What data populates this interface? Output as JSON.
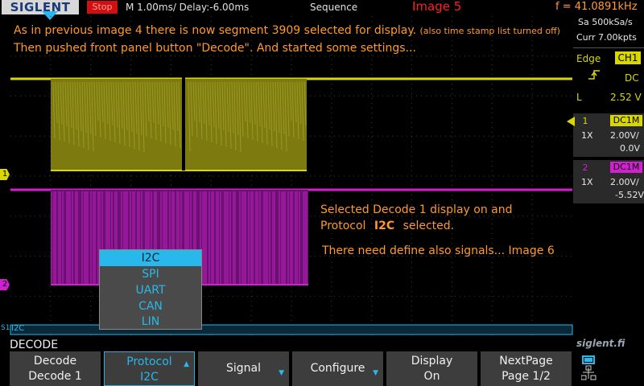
{
  "topbar": {
    "logo": "SIGLENT",
    "run_state": "Stop",
    "timebase": "M 1.00ms/ Delay:-6.00ms",
    "mode": "Sequence",
    "image_tag": "Image 5",
    "frequency": "f = 41.0891kHz"
  },
  "annotations": {
    "line1_main": "As in previous image 4 there is now segment 3909 selected for display.",
    "line1_small": "(also time stamp list turned off)",
    "line2": "Then pushed front panel button \"Decode\".  And started some settings...",
    "selected_decode": "Selected Decode 1 display on and",
    "protocol_prefix": "Protocol",
    "protocol_value": "I2C",
    "protocol_suffix": "selected.",
    "need_define": "There need define also signals... Image 6"
  },
  "right_panel": {
    "sample_rate": "Sa 500kSa/s",
    "memory": "Curr 7.00kpts",
    "trigger_type": "Edge",
    "trigger_source": "CH1",
    "coupling": "DC",
    "level_label": "L",
    "level_value": "2.52 V",
    "ch1": {
      "num": "1",
      "coupling": "DC1M",
      "probe": "1X",
      "scale": "2.00V/",
      "offset": "0.0V"
    },
    "ch2": {
      "num": "2",
      "coupling": "DC1M",
      "probe": "1X",
      "scale": "2.00V/",
      "offset": "-5.52V"
    },
    "watermark": "siglent.fi"
  },
  "markers": {
    "ch1": "1",
    "ch2": "2",
    "bus": "S1",
    "bus_label": "I2C"
  },
  "menu_title": "DECODE",
  "protocol_menu": {
    "options": [
      "I2C",
      "SPI",
      "UART",
      "CAN",
      "LIN"
    ],
    "selected_index": 0
  },
  "softkeys": [
    {
      "top": "Decode",
      "bottom": "Decode 1"
    },
    {
      "top": "Protocol",
      "bottom": "I2C"
    },
    {
      "top": "Signal",
      "bottom": ""
    },
    {
      "top": "Configure",
      "bottom": ""
    },
    {
      "top": "Display",
      "bottom": "On"
    },
    {
      "top": "NextPage",
      "bottom": "Page 1/2"
    }
  ],
  "colors": {
    "ch1": "#d8d800",
    "ch1_fill": "#7d7a10",
    "ch2": "#d020d0",
    "ch2_fill": "#6a1070",
    "accent": "#29b8ec",
    "annotation": "#ff9a2a"
  }
}
